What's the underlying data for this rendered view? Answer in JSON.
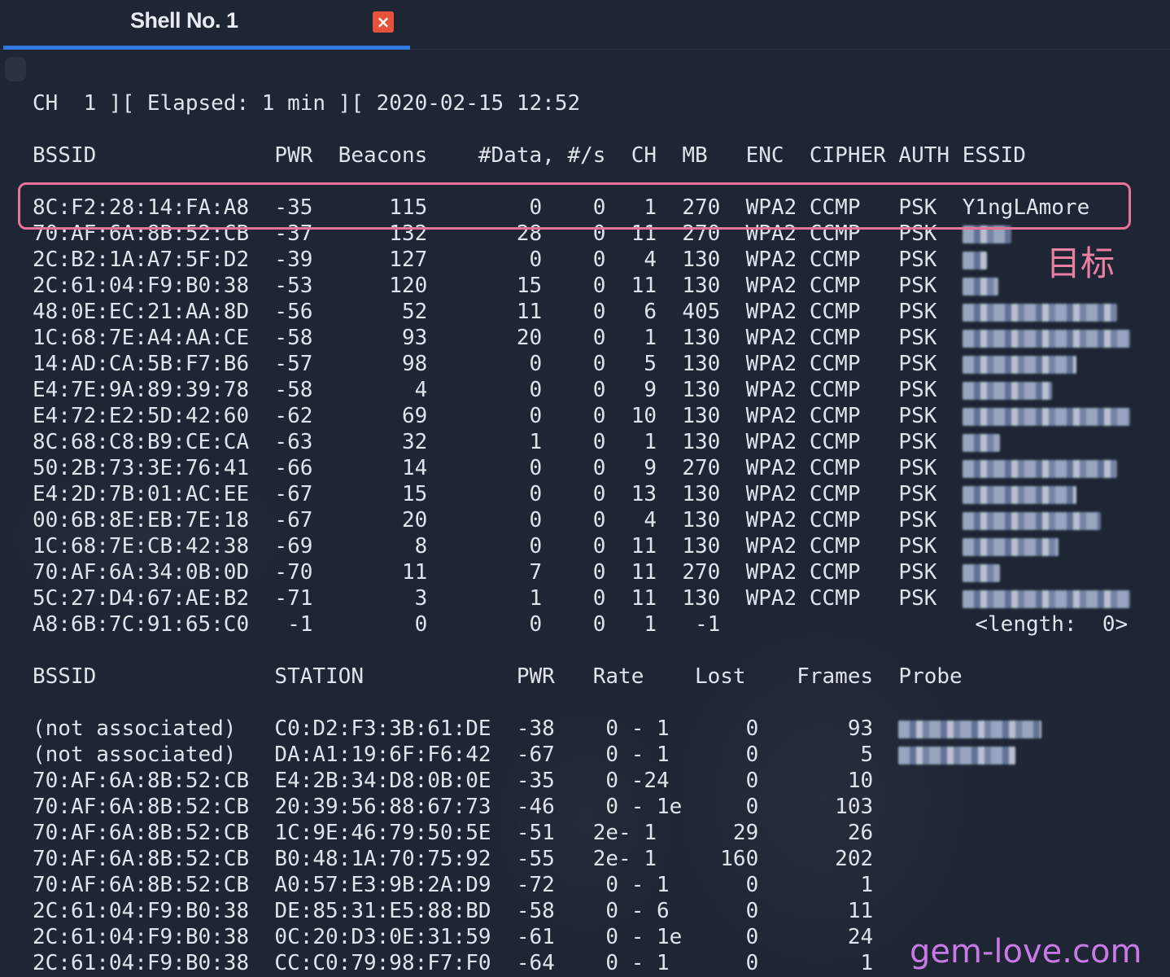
{
  "tab": {
    "title": "Shell No. 1",
    "close_icon": "×"
  },
  "status_line": "CH  1 ][ Elapsed: 1 min ][ 2020-02-15 12:52",
  "ap_header": "BSSID              PWR  Beacons    #Data, #/s  CH  MB   ENC  CIPHER AUTH ESSID",
  "access_points": [
    {
      "line": "8C:F2:28:14:FA:A8  -35      115        0    0   1  270  WPA2 CCMP   PSK  ",
      "essid": "Y1ngLAmore",
      "blur": 0
    },
    {
      "line": "70:AF:6A:8B:52:CB  -37      132       28    0  11  270  WPA2 CCMP   PSK  ",
      "essid": "",
      "blur": 60
    },
    {
      "line": "2C:B2:1A:A7:5F:D2  -39      127        0    0   4  130  WPA2 CCMP   PSK  ",
      "essid": "",
      "blur": 30
    },
    {
      "line": "2C:61:04:F9:B0:38  -53      120       15    0  11  130  WPA2 CCMP   PSK  ",
      "essid": "",
      "blur": 44
    },
    {
      "line": "48:0E:EC:21:AA:8D  -56       52       11    0   6  405  WPA2 CCMP   PSK  ",
      "essid": "",
      "blur": 190
    },
    {
      "line": "1C:68:7E:A4:AA:CE  -58       93       20    0   1  130  WPA2 CCMP   PSK  ",
      "essid": "",
      "blur": 206
    },
    {
      "line": "14:AD:CA:5B:F7:B6  -57       98        0    0   5  130  WPA2 CCMP   PSK  ",
      "essid": "",
      "blur": 140
    },
    {
      "line": "E4:7E:9A:89:39:78  -58        4        0    0   9  130  WPA2 CCMP   PSK  ",
      "essid": "",
      "blur": 110
    },
    {
      "line": "E4:72:E2:5D:42:60  -62       69        0    0  10  130  WPA2 CCMP   PSK  ",
      "essid": "",
      "blur": 206
    },
    {
      "line": "8C:68:C8:B9:CE:CA  -63       32        1    0   1  130  WPA2 CCMP   PSK  ",
      "essid": "",
      "blur": 46
    },
    {
      "line": "50:2B:73:3E:76:41  -66       14        0    0   9  270  WPA2 CCMP   PSK  ",
      "essid": "",
      "blur": 190
    },
    {
      "line": "E4:2D:7B:01:AC:EE  -67       15        0    0  13  130  WPA2 CCMP   PSK  ",
      "essid": "",
      "blur": 140
    },
    {
      "line": "00:6B:8E:EB:7E:18  -67       20        0    0   4  130  WPA2 CCMP   PSK  ",
      "essid": "",
      "blur": 170
    },
    {
      "line": "1C:68:7E:CB:42:38  -69        8        0    0  11  130  WPA2 CCMP   PSK  ",
      "essid": "",
      "blur": 118
    },
    {
      "line": "70:AF:6A:34:0B:0D  -70       11        7    0  11  270  WPA2 CCMP   PSK  ",
      "essid": "",
      "blur": 46
    },
    {
      "line": "5C:27:D4:67:AE:B2  -71        3        1    0  11  130  WPA2 CCMP   PSK  ",
      "essid": "",
      "blur": 206
    },
    {
      "line": "A8:6B:7C:91:65:C0   -1        0        0    0   1   -1                    ",
      "essid": "<length:  0>",
      "blur": 0
    }
  ],
  "station_header": "BSSID              STATION            PWR   Rate    Lost    Frames  Probe",
  "stations": [
    {
      "line": "(not associated)   C0:D2:F3:3B:61:DE  -38    0 - 1      0       93  ",
      "blur": 176
    },
    {
      "line": "(not associated)   DA:A1:19:6F:F6:42  -67    0 - 1      0        5  ",
      "blur": 144
    },
    {
      "line": "70:AF:6A:8B:52:CB  E4:2B:34:D8:0B:0E  -35    0 -24      0       10  ",
      "blur": 0
    },
    {
      "line": "70:AF:6A:8B:52:CB  20:39:56:88:67:73  -46    0 - 1e     0      103  ",
      "blur": 0
    },
    {
      "line": "70:AF:6A:8B:52:CB  1C:9E:46:79:50:5E  -51   2e- 1      29       26  ",
      "blur": 0
    },
    {
      "line": "70:AF:6A:8B:52:CB  B0:48:1A:70:75:92  -55   2e- 1     160      202  ",
      "blur": 0
    },
    {
      "line": "70:AF:6A:8B:52:CB  A0:57:E3:9B:2A:D9  -72    0 - 1      0        1  ",
      "blur": 0
    },
    {
      "line": "2C:61:04:F9:B0:38  DE:85:31:E5:88:BD  -58    0 - 6      0       11  ",
      "blur": 0
    },
    {
      "line": "2C:61:04:F9:B0:38  0C:20:D3:0E:31:59  -61    0 - 1e     0       24  ",
      "blur": 0
    },
    {
      "line": "2C:61:04:F9:B0:38  CC:C0:79:98:F7:F0  -64    0 - 1      0        1  ",
      "blur": 0
    }
  ],
  "annotation": "目标",
  "watermark": "gem-love.com"
}
